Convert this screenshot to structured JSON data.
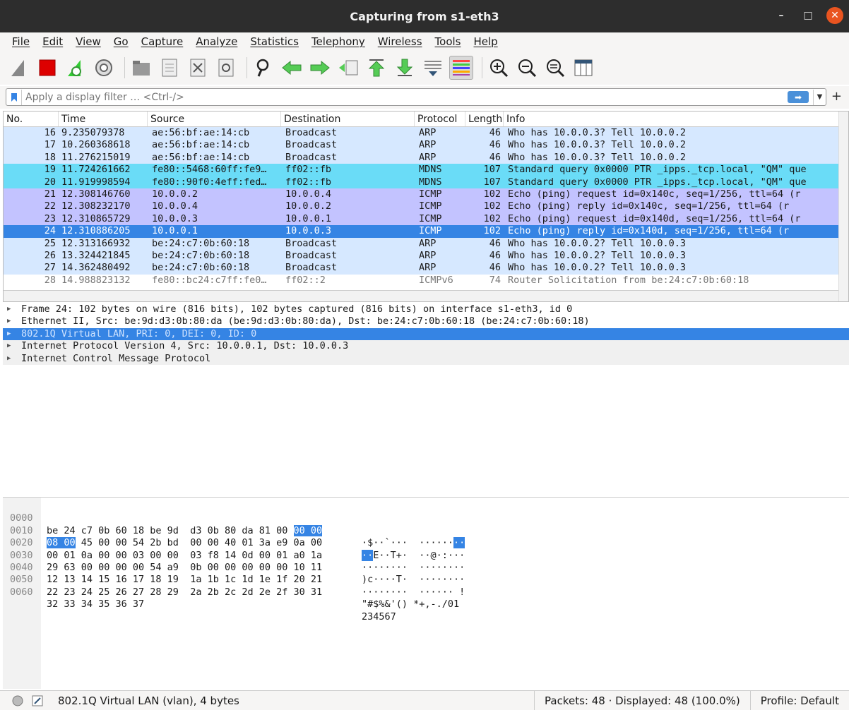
{
  "window": {
    "title": "Capturing from s1-eth3"
  },
  "menu": [
    "File",
    "Edit",
    "View",
    "Go",
    "Capture",
    "Analyze",
    "Statistics",
    "Telephony",
    "Wireless",
    "Tools",
    "Help"
  ],
  "filter": {
    "placeholder": "Apply a display filter … <Ctrl-/>"
  },
  "columns": [
    "No.",
    "Time",
    "Source",
    "Destination",
    "Protocol",
    "Length",
    "Info"
  ],
  "packets": [
    {
      "no": "16",
      "time": "9.235079378",
      "src": "ae:56:bf:ae:14:cb",
      "dst": "Broadcast",
      "proto": "ARP",
      "len": "46",
      "info": "Who has 10.0.0.3? Tell 10.0.0.2",
      "cls": "arp"
    },
    {
      "no": "17",
      "time": "10.260368618",
      "src": "ae:56:bf:ae:14:cb",
      "dst": "Broadcast",
      "proto": "ARP",
      "len": "46",
      "info": "Who has 10.0.0.3? Tell 10.0.0.2",
      "cls": "arp"
    },
    {
      "no": "18",
      "time": "11.276215019",
      "src": "ae:56:bf:ae:14:cb",
      "dst": "Broadcast",
      "proto": "ARP",
      "len": "46",
      "info": "Who has 10.0.0.3? Tell 10.0.0.2",
      "cls": "arp"
    },
    {
      "no": "19",
      "time": "11.724261662",
      "src": "fe80::5468:60ff:fe9…",
      "dst": "ff02::fb",
      "proto": "MDNS",
      "len": "107",
      "info": "Standard query 0x0000 PTR _ipps._tcp.local, \"QM\" que",
      "cls": "mdns"
    },
    {
      "no": "20",
      "time": "11.919998594",
      "src": "fe80::90f0:4eff:fed…",
      "dst": "ff02::fb",
      "proto": "MDNS",
      "len": "107",
      "info": "Standard query 0x0000 PTR _ipps._tcp.local, \"QM\" que",
      "cls": "mdns"
    },
    {
      "no": "21",
      "time": "12.308146760",
      "src": "10.0.0.2",
      "dst": "10.0.0.4",
      "proto": "ICMP",
      "len": "102",
      "info": "Echo (ping) request  id=0x140c, seq=1/256, ttl=64 (r",
      "cls": "icmp"
    },
    {
      "no": "22",
      "time": "12.308232170",
      "src": "10.0.0.4",
      "dst": "10.0.0.2",
      "proto": "ICMP",
      "len": "102",
      "info": "Echo (ping) reply    id=0x140c, seq=1/256, ttl=64 (r",
      "cls": "icmp"
    },
    {
      "no": "23",
      "time": "12.310865729",
      "src": "10.0.0.3",
      "dst": "10.0.0.1",
      "proto": "ICMP",
      "len": "102",
      "info": "Echo (ping) request  id=0x140d, seq=1/256, ttl=64 (r",
      "cls": "icmp"
    },
    {
      "no": "24",
      "time": "12.310886205",
      "src": "10.0.0.1",
      "dst": "10.0.0.3",
      "proto": "ICMP",
      "len": "102",
      "info": "Echo (ping) reply    id=0x140d, seq=1/256, ttl=64 (r",
      "cls": "sel"
    },
    {
      "no": "25",
      "time": "12.313166932",
      "src": "be:24:c7:0b:60:18",
      "dst": "Broadcast",
      "proto": "ARP",
      "len": "46",
      "info": "Who has 10.0.0.2? Tell 10.0.0.3",
      "cls": "arp"
    },
    {
      "no": "26",
      "time": "13.324421845",
      "src": "be:24:c7:0b:60:18",
      "dst": "Broadcast",
      "proto": "ARP",
      "len": "46",
      "info": "Who has 10.0.0.2? Tell 10.0.0.3",
      "cls": "arp"
    },
    {
      "no": "27",
      "time": "14.362480492",
      "src": "be:24:c7:0b:60:18",
      "dst": "Broadcast",
      "proto": "ARP",
      "len": "46",
      "info": "Who has 10.0.0.2? Tell 10.0.0.3",
      "cls": "arp"
    },
    {
      "no": "28",
      "time": "14.988823132",
      "src": "fe80::bc24:c7ff:fe0…",
      "dst": "ff02::2",
      "proto": "ICMPv6",
      "len": "74",
      "info": "Router Solicitation from be:24:c7:0b:60:18",
      "cls": "icmp6"
    }
  ],
  "details": [
    {
      "text": "Frame 24: 102 bytes on wire (816 bits), 102 bytes captured (816 bits) on interface s1-eth3, id 0",
      "cls": ""
    },
    {
      "text": "Ethernet II, Src: be:9d:d3:0b:80:da (be:9d:d3:0b:80:da), Dst: be:24:c7:0b:60:18 (be:24:c7:0b:60:18)",
      "cls": ""
    },
    {
      "text": "802.1Q Virtual LAN, PRI: 0, DEI: 0, ID: 0",
      "cls": "hl"
    },
    {
      "text": "Internet Protocol Version 4, Src: 10.0.0.1, Dst: 10.0.0.3",
      "cls": "gray"
    },
    {
      "text": "Internet Control Message Protocol",
      "cls": "gray"
    }
  ],
  "hex": [
    {
      "off": "0000",
      "a": "be 24 c7 0b 60 18 be 9d",
      "b": "d3 0b 80 da 81 00",
      "bh": "00 00",
      "asc": "·$··`···  ······",
      "asch": "··",
      "hl_first": false
    },
    {
      "off": "0010",
      "ah": "08 00",
      "a": " 45 00 00 54 2b bd",
      "b": "00 00 40 01 3a e9 0a 00",
      "asc2": "E··T+·  ··@·:···",
      "asch": "··",
      "hl_first": true
    },
    {
      "off": "0020",
      "a": "00 01 0a 00 00 03 00 00",
      "b": "03 f8 14 0d 00 01 a0 1a",
      "asc": "········  ········"
    },
    {
      "off": "0030",
      "a": "29 63 00 00 00 00 54 a9",
      "b": "0b 00 00 00 00 00 10 11",
      "asc": ")c····T·  ········"
    },
    {
      "off": "0040",
      "a": "12 13 14 15 16 17 18 19",
      "b": "1a 1b 1c 1d 1e 1f 20 21",
      "asc": "········  ······ !"
    },
    {
      "off": "0050",
      "a": "22 23 24 25 26 27 28 29",
      "b": "2a 2b 2c 2d 2e 2f 30 31",
      "asc": "\"#$%&'() *+,-./01"
    },
    {
      "off": "0060",
      "a": "32 33 34 35 36 37",
      "b": "",
      "asc": "234567"
    }
  ],
  "status": {
    "left": "802.1Q Virtual LAN (vlan), 4 bytes",
    "packets": "Packets: 48 · Displayed: 48 (100.0%)",
    "profile": "Profile: Default"
  }
}
